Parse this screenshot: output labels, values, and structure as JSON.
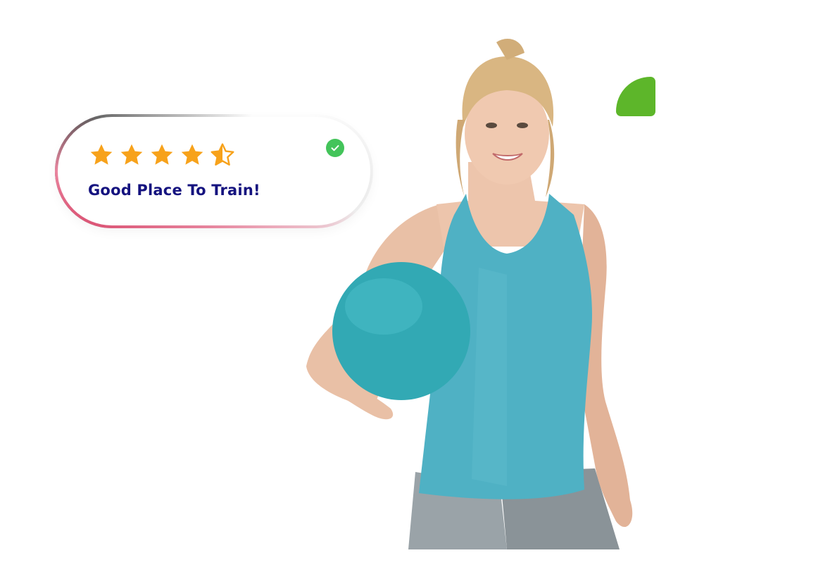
{
  "review": {
    "rating": 4.5,
    "max_rating": 5,
    "text": "Good Place To Train!",
    "verified": true,
    "star_color": "#f7a21b",
    "text_color": "#15137f",
    "check_color": "#43c45a"
  },
  "accent": {
    "leaf_color": "#5db62a"
  },
  "image": {
    "subject": "woman-holding-exercise-ball"
  }
}
